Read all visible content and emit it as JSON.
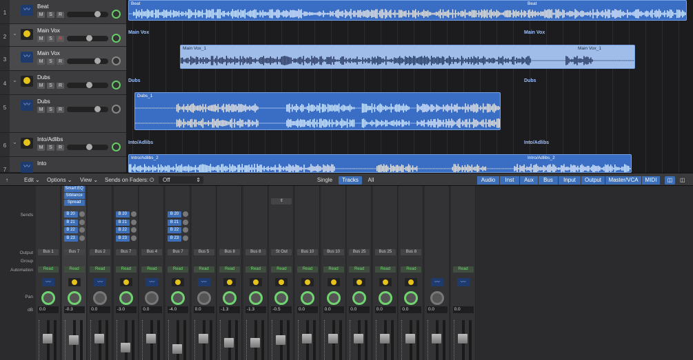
{
  "tracks": [
    {
      "num": "1",
      "name": "Beat",
      "kind": "audio",
      "selected": false
    },
    {
      "num": "2",
      "name": "Main Vox",
      "kind": "summing",
      "selected": true,
      "rec": true
    },
    {
      "num": "3",
      "name": "Main Vox",
      "kind": "audio",
      "selected": true
    },
    {
      "num": "4",
      "name": "Dubs",
      "kind": "summing",
      "selected": false
    },
    {
      "num": "5",
      "name": "Dubs",
      "kind": "audio",
      "selected": false
    },
    {
      "num": "6",
      "name": "Into/Adlibs",
      "kind": "summing",
      "selected": false
    },
    {
      "num": "7",
      "name": "Into",
      "kind": "audio",
      "selected": false
    }
  ],
  "msr": {
    "mute": "M",
    "solo": "S",
    "rec": "R"
  },
  "lanes": {
    "main_vox_label": "Main Vox",
    "dubs_label": "Dubs",
    "intro_label": "Into/Adlibs"
  },
  "regions": {
    "beat": "Beat",
    "main_vox_1": "Main Vox_1",
    "dubs_1": "Dubs_1",
    "intro_adlibs_2": "Intro/Adlibs_2"
  },
  "mixer_bar": {
    "edit": "Edit",
    "options": "Options",
    "view": "View",
    "sends_on_faders": "Sends on Faders:",
    "sends_value": "Off",
    "single": "Single",
    "tracks": "Tracks",
    "all": "All",
    "categories": [
      "Audio",
      "Inst",
      "Aux",
      "Bus",
      "Input",
      "Output",
      "Master/VCA",
      "MIDI"
    ]
  },
  "row_labels": {
    "sends": "Sends",
    "output": "Output",
    "group": "Group",
    "automation": "Automation",
    "pan": "Pan",
    "db": "dB"
  },
  "plugins": [
    "Smart:EQ",
    "Sibilance",
    "Spread"
  ],
  "strips": [
    {
      "output": "Bus 1",
      "auto": "Read",
      "db": "0.0",
      "type": "audio",
      "sends": [],
      "pan_grey": false,
      "fader": 0.55
    },
    {
      "output": "Bus 7",
      "auto": "Read",
      "db": "-0.3",
      "type": "tuner",
      "sends": [
        "B 20",
        "B 21",
        "B 22",
        "B 23"
      ],
      "pan_grey": false,
      "fader": 0.5,
      "sel": true
    },
    {
      "output": "Bus 2",
      "auto": "Read",
      "db": "0.0",
      "type": "audio",
      "sends": [],
      "pan_grey": true,
      "fader": 0.55
    },
    {
      "output": "Bus 7",
      "auto": "Read",
      "db": "-3.0",
      "type": "tuner",
      "sends": [
        "B 20",
        "B 21",
        "B 22",
        "B 23"
      ],
      "pan_grey": false,
      "fader": 0.25
    },
    {
      "output": "Bus 4",
      "auto": "Read",
      "db": "0.0",
      "type": "audio",
      "sends": [],
      "pan_grey": true,
      "fader": 0.55
    },
    {
      "output": "Bus 7",
      "auto": "Read",
      "db": "-4.0",
      "type": "tuner",
      "sends": [
        "B 20",
        "B 21",
        "B 22",
        "B 23"
      ],
      "pan_grey": false,
      "fader": 0.2
    },
    {
      "output": "Bus 5",
      "auto": "Read",
      "db": "0.0",
      "type": "audio",
      "sends": [],
      "pan_grey": true,
      "fader": 0.55
    },
    {
      "output": "Bus 8",
      "auto": "Read",
      "db": "-1.3",
      "type": "tuner",
      "sends": [],
      "pan_grey": false,
      "fader": 0.4
    },
    {
      "output": "Bus 8",
      "auto": "Read",
      "db": "-1.3",
      "type": "tuner",
      "sends": [],
      "pan_grey": false,
      "fader": 0.4
    },
    {
      "output": "St Out",
      "auto": "Read",
      "db": "-0.5",
      "type": "tuner",
      "sends": [],
      "pan_grey": false,
      "fader": 0.5,
      "select": true
    },
    {
      "output": "Bus 10",
      "auto": "Read",
      "db": "0.0",
      "type": "tuner",
      "sends": [],
      "pan_grey": false,
      "fader": 0.55
    },
    {
      "output": "Bus 10",
      "auto": "Read",
      "db": "0.0",
      "type": "tuner",
      "sends": [],
      "pan_grey": false,
      "fader": 0.55
    },
    {
      "output": "Bus 25",
      "auto": "Read",
      "db": "0.0",
      "type": "tuner",
      "sends": [],
      "pan_grey": false,
      "fader": 0.55
    },
    {
      "output": "Bus 25",
      "auto": "Read",
      "db": "0.0",
      "type": "tuner",
      "sends": [],
      "pan_grey": false,
      "fader": 0.55
    },
    {
      "output": "Bus 8",
      "auto": "Read",
      "db": "0.0",
      "type": "tuner",
      "sends": [],
      "pan_grey": false,
      "fader": 0.55
    },
    {
      "output": "",
      "auto": "",
      "db": "0.0",
      "type": "audio",
      "sends": [],
      "pan_grey": true,
      "fader": 0.55
    },
    {
      "output": "",
      "auto": "Read",
      "db": "0.0",
      "type": "audio",
      "sends": [],
      "pan_grey": true,
      "fader": 0.55,
      "nopan": true
    }
  ]
}
